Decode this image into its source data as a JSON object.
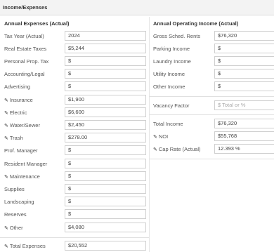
{
  "header": {
    "title": "Income/Expenses"
  },
  "expenses": {
    "heading": "Annual Expenses (Actual)",
    "rows": [
      {
        "label": "Tax Year (Actual)",
        "value": "2024",
        "pin": false
      },
      {
        "label": "Real Estate Taxes",
        "value": "$5,244",
        "pin": false
      },
      {
        "label": "Personal Prop. Tax",
        "value": "$",
        "pin": false
      },
      {
        "label": "Accounting/Legal",
        "value": "$",
        "pin": false
      },
      {
        "label": "Advertising",
        "value": "$",
        "pin": false
      },
      {
        "label": "Insurance",
        "value": "$1,900",
        "pin": true
      },
      {
        "label": "Electric",
        "value": "$6,600",
        "pin": true
      },
      {
        "label": "Water/Sewer",
        "value": "$2,450",
        "pin": true
      },
      {
        "label": "Trash",
        "value": "$278.00",
        "pin": true
      },
      {
        "label": "Prof. Manager",
        "value": "$",
        "pin": false
      },
      {
        "label": "Resident Manager",
        "value": "$",
        "pin": false
      },
      {
        "label": "Maintenance",
        "value": "$",
        "pin": true
      },
      {
        "label": "Supplies",
        "value": "$",
        "pin": false
      },
      {
        "label": "Landscaping",
        "value": "$",
        "pin": false
      },
      {
        "label": "Reserves",
        "value": "$",
        "pin": false
      },
      {
        "label": "Other",
        "value": "$4,080",
        "pin": true
      }
    ],
    "total": {
      "label": "Total Expenses",
      "value": "$20,552",
      "pin": true
    }
  },
  "income": {
    "heading": "Annual Operating Income (Actual)",
    "rows": [
      {
        "label": "Gross Sched. Rents",
        "value": "$76,320"
      },
      {
        "label": "Parking Income",
        "value": "$"
      },
      {
        "label": "Laundry Income",
        "value": "$"
      },
      {
        "label": "Utility Income",
        "value": "$"
      },
      {
        "label": "Other Income",
        "value": "$"
      }
    ],
    "vacancy": {
      "label": "Vacancy Factor",
      "placeholder": "$ Total or %"
    },
    "totals": [
      {
        "label": "Total Income",
        "value": "$76,320",
        "pin": false
      },
      {
        "label": "NOI",
        "value": "$55,768",
        "pin": true
      },
      {
        "label": "Cap Rate (Actual)",
        "value": "12.393 %",
        "pin": true
      }
    ]
  },
  "icons": {
    "pin": "pencil-icon"
  }
}
